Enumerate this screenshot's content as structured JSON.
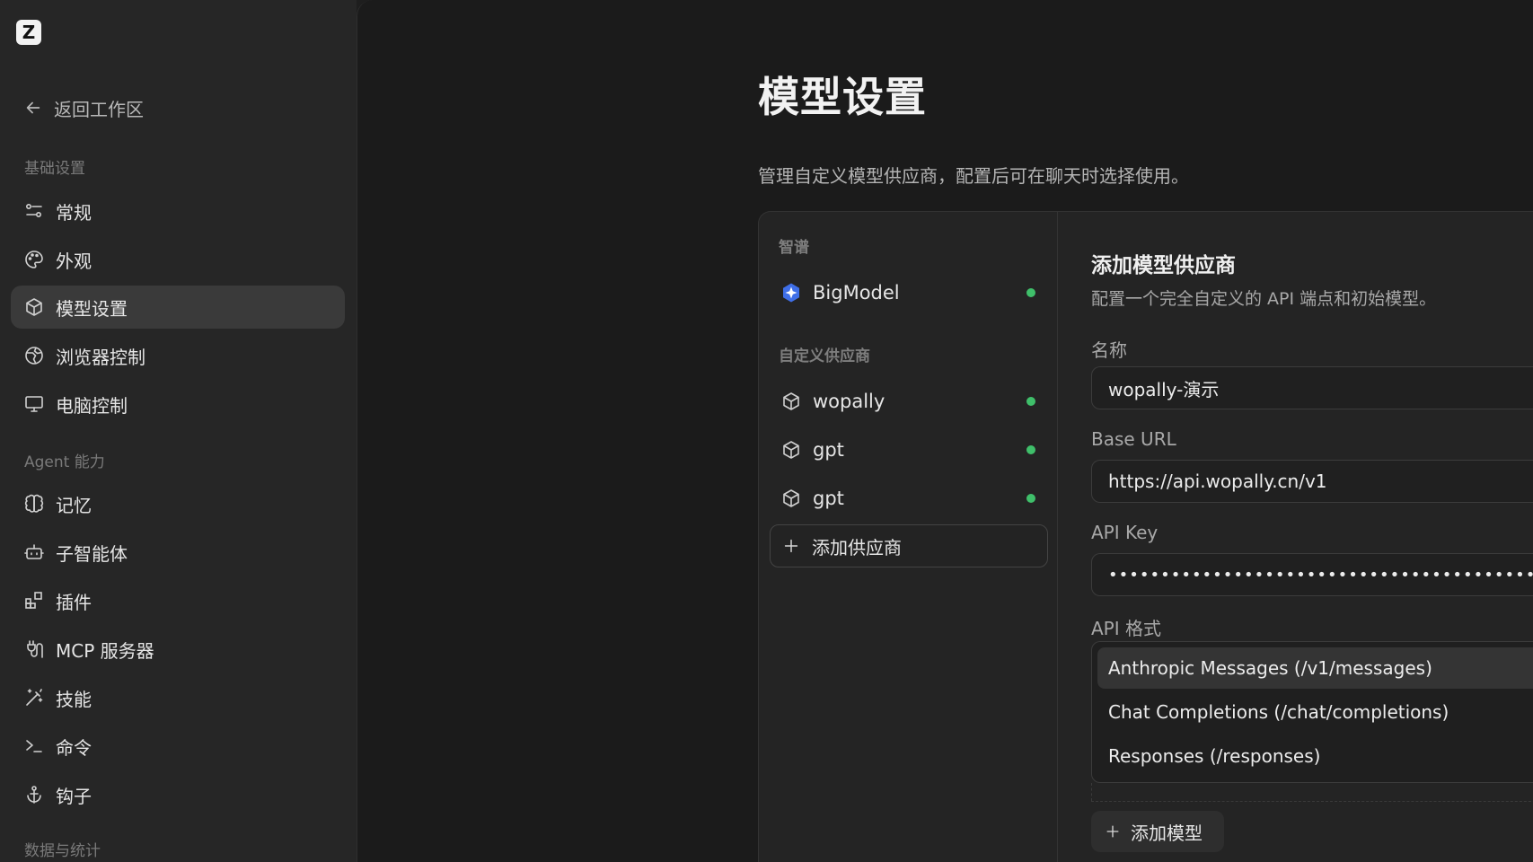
{
  "app": {
    "logo_letter": "Z"
  },
  "sidebar": {
    "back_label": "返回工作区",
    "sections": [
      {
        "label": "基础设置"
      },
      {
        "label": "Agent 能力"
      },
      {
        "label": "数据与统计"
      }
    ],
    "items": [
      {
        "label": "常规",
        "icon": "sliders-icon"
      },
      {
        "label": "外观",
        "icon": "palette-icon"
      },
      {
        "label": "模型设置",
        "icon": "box-icon",
        "active": true
      },
      {
        "label": "浏览器控制",
        "icon": "globe-icon"
      },
      {
        "label": "电脑控制",
        "icon": "monitor-icon"
      },
      {
        "label": "记忆",
        "icon": "brain-icon"
      },
      {
        "label": "子智能体",
        "icon": "bot-icon"
      },
      {
        "label": "插件",
        "icon": "blocks-icon"
      },
      {
        "label": "MCP 服务器",
        "icon": "plug-icon"
      },
      {
        "label": "技能",
        "icon": "wand-icon"
      },
      {
        "label": "命令",
        "icon": "terminal-icon"
      },
      {
        "label": "钩子",
        "icon": "anchor-icon"
      }
    ]
  },
  "main": {
    "title": "模型设置",
    "description": "管理自定义模型供应商，配置后可在聊天时选择使用。"
  },
  "providers": {
    "groups": [
      {
        "label": "智谱",
        "items": [
          {
            "name": "BigModel",
            "status": "active"
          }
        ]
      },
      {
        "label": "自定义供应商",
        "items": [
          {
            "name": "wopally",
            "status": "active"
          },
          {
            "name": "gpt",
            "status": "active"
          },
          {
            "name": "gpt",
            "status": "active"
          }
        ]
      }
    ],
    "add_label": "添加供应商",
    "status_color": "#3fbf6a"
  },
  "form": {
    "title": "添加模型供应商",
    "subtitle": "配置一个完全自定义的 API 端点和初始模型。",
    "name_label": "名称",
    "name_value": "wopally-演示",
    "base_url_label": "Base URL",
    "base_url_value": "https://api.wopally.cn/v1",
    "api_key_label": "API Key",
    "api_key_value": "••••••••••••••••••••••••••••••••••••••••••••••••••••••",
    "api_format_label": "API 格式",
    "api_format_options": [
      "Anthropic Messages (/v1/messages)",
      "Chat Completions (/chat/completions)",
      "Responses (/responses)"
    ],
    "api_format_selected": "Anthropic Messages (/v1/messages)",
    "add_model_label": "添加模型"
  }
}
